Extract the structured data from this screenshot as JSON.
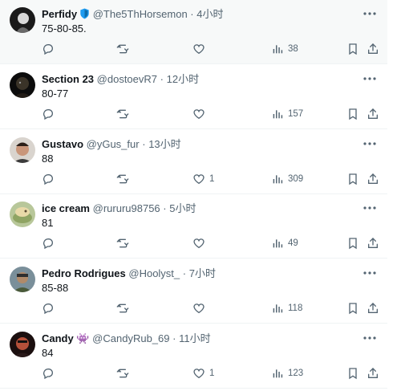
{
  "tweets": [
    {
      "name": "Perfidy",
      "handle": "@The5ThHorsemon",
      "sep": "·",
      "time": "4小时",
      "text": "75-80-85.",
      "replies": "",
      "retweets": "",
      "likes": "",
      "views": "38",
      "verified": true,
      "emoji": ""
    },
    {
      "name": "Section 23",
      "handle": "@dostoevR7",
      "sep": "·",
      "time": "12小时",
      "text": "80-77",
      "replies": "",
      "retweets": "",
      "likes": "",
      "views": "157",
      "verified": false,
      "emoji": ""
    },
    {
      "name": "Gustavo",
      "handle": "@yGus_fur",
      "sep": "·",
      "time": "13小时",
      "text": "88",
      "replies": "",
      "retweets": "",
      "likes": "1",
      "views": "309",
      "verified": false,
      "emoji": ""
    },
    {
      "name": "ice cream",
      "handle": "@rururu98756",
      "sep": "·",
      "time": "5小时",
      "text": "81",
      "replies": "",
      "retweets": "",
      "likes": "",
      "views": "49",
      "verified": false,
      "emoji": ""
    },
    {
      "name": "Pedro Rodrigues",
      "handle": "@Hoolyst_",
      "sep": "·",
      "time": "7小时",
      "text": "85-88",
      "replies": "",
      "retweets": "",
      "likes": "",
      "views": "118",
      "verified": false,
      "emoji": ""
    },
    {
      "name": "Candy",
      "handle": "@CandyRub_69",
      "sep": "·",
      "time": "11小时",
      "text": "84",
      "replies": "",
      "retweets": "",
      "likes": "1",
      "views": "123",
      "verified": false,
      "emoji": "👾"
    }
  ],
  "icons": {
    "reply": "reply-icon",
    "retweet": "retweet-icon",
    "like": "heart-icon",
    "views": "views-icon",
    "bookmark": "bookmark-icon",
    "share": "share-icon",
    "more": "more-icon",
    "verified": "verified-shield-icon"
  },
  "colors": {
    "text": "#0f1419",
    "muted": "#536471",
    "verified": "#1d9bf0",
    "divider": "#eff3f4",
    "highlight": "#f7f9f9"
  }
}
